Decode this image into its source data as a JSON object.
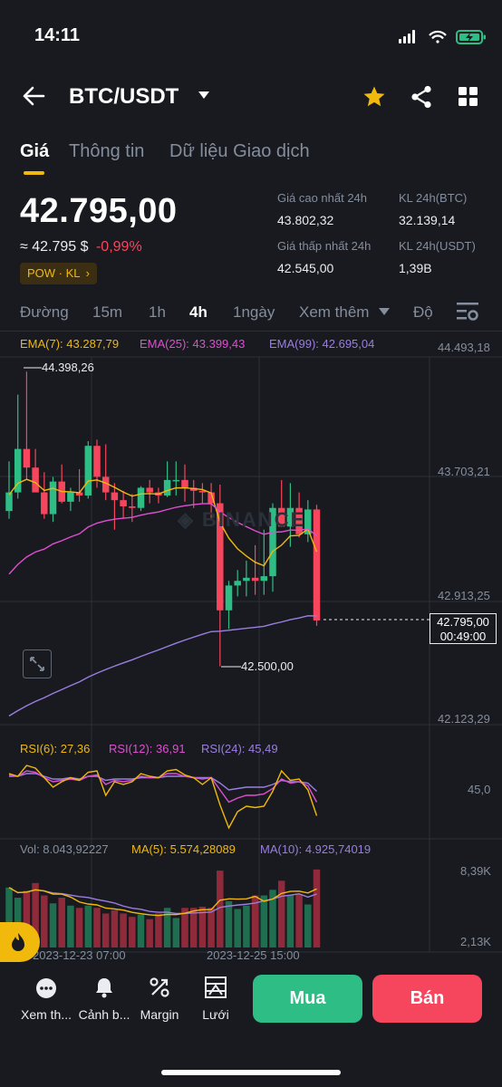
{
  "status": {
    "time": "14:11"
  },
  "header": {
    "pair": "BTC/USDT"
  },
  "tabs": [
    {
      "label": "Giá"
    },
    {
      "label": "Thông tin"
    },
    {
      "label": "Dữ liệu Giao dịch"
    }
  ],
  "ticker": {
    "last_price": "42.795,00",
    "fiat_price": "≈ 42.795 $",
    "change": "-0,99%",
    "tags": "POW · KL",
    "stats": [
      {
        "label": "Giá cao nhất 24h",
        "value": "43.802,32"
      },
      {
        "label": "KL 24h(BTC)",
        "value": "32.139,14"
      },
      {
        "label": "Giá thấp nhất 24h",
        "value": "42.545,00"
      },
      {
        "label": "KL 24h(USDT)",
        "value": "1,39B"
      }
    ]
  },
  "intervals": {
    "items": [
      "Đường",
      "15m",
      "1h",
      "4h",
      "1ngày"
    ],
    "more": "Xem thêm",
    "depth": "Độ"
  },
  "main_chart": {
    "ema7": "EMA(7): 43.287,79",
    "ema25": "EMA(25): 43.399,43",
    "ema99": "EMA(99): 42.695,04",
    "y_labels": [
      "44.493,18",
      "43.703,21",
      "42.913,25",
      "42.123,29"
    ],
    "high_marker": "44.398,26",
    "low_marker": "42.500,00",
    "current_price": "42.795,00",
    "countdown": "00:49:00"
  },
  "rsi": {
    "rsi6": "RSI(6): 27,36",
    "rsi12": "RSI(12): 36,91",
    "rsi24": "RSI(24): 45,49",
    "level": "45,0"
  },
  "volume": {
    "vol": "Vol: 8.043,92227",
    "ma5": "MA(5): 5.574,28089",
    "ma10": "MA(10): 4.925,74019",
    "top_label": "8,39K",
    "bottom_label": "2,13K",
    "dates": [
      "2023-12-23 07:00",
      "2023-12-25 15:00"
    ]
  },
  "bottom_nav": {
    "items": [
      {
        "label": "Xem th..."
      },
      {
        "label": "Cảnh b..."
      },
      {
        "label": "Margin"
      },
      {
        "label": "Lưới"
      }
    ],
    "buy": "Mua",
    "sell": "Bán"
  },
  "colors": {
    "up": "#2ebd85",
    "down": "#f6465d",
    "accent": "#f0b90b",
    "bg": "#181a20"
  },
  "candles": [
    [
      43500,
      43820,
      43450,
      43620
    ],
    [
      43620,
      44250,
      43580,
      43900
    ],
    [
      43900,
      44398,
      43700,
      43780
    ],
    [
      43780,
      43900,
      43700,
      43620
    ],
    [
      43620,
      43750,
      43450,
      43480
    ],
    [
      43480,
      43720,
      43430,
      43690
    ],
    [
      43690,
      43800,
      43550,
      43560
    ],
    [
      43560,
      43650,
      43500,
      43620
    ],
    [
      43620,
      43770,
      43560,
      43600
    ],
    [
      43600,
      43950,
      43580,
      43920
    ],
    [
      43920,
      43960,
      43650,
      43720
    ],
    [
      43720,
      43930,
      43570,
      43620
    ],
    [
      43620,
      43680,
      43380,
      43570
    ],
    [
      43570,
      43630,
      43450,
      43530
    ],
    [
      43530,
      43610,
      43430,
      43520
    ],
    [
      43520,
      43660,
      43500,
      43650
    ],
    [
      43650,
      43700,
      43550,
      43620
    ],
    [
      43620,
      43650,
      43550,
      43600
    ],
    [
      43600,
      43820,
      43590,
      43700
    ],
    [
      43700,
      43820,
      43600,
      43700
    ],
    [
      43700,
      43800,
      43560,
      43650
    ],
    [
      43650,
      43700,
      43520,
      43630
    ],
    [
      43630,
      43680,
      43550,
      43620
    ],
    [
      43620,
      43680,
      43450,
      43550
    ],
    [
      43550,
      43670,
      42500,
      42860
    ],
    [
      42860,
      43050,
      42740,
      43020
    ],
    [
      43020,
      43120,
      42950,
      43050
    ],
    [
      43050,
      43180,
      42950,
      43070
    ],
    [
      43070,
      43280,
      42960,
      43050
    ],
    [
      43050,
      43380,
      42960,
      43080
    ],
    [
      43080,
      43550,
      42980,
      43520
    ],
    [
      43520,
      43700,
      43400,
      43400
    ],
    [
      43400,
      43680,
      43270,
      43520
    ],
    [
      43520,
      43620,
      43330,
      43350
    ],
    [
      43350,
      43570,
      43300,
      43510
    ],
    [
      43510,
      43540,
      42760,
      42795
    ]
  ],
  "rsi_series": {
    "rsi6": [
      58,
      56,
      64,
      62,
      55,
      48,
      52,
      55,
      53,
      59,
      60,
      42,
      52,
      50,
      52,
      58,
      56,
      55,
      60,
      61,
      57,
      55,
      50,
      55,
      35,
      18,
      30,
      34,
      33,
      34,
      45,
      60,
      53,
      54,
      46,
      27
    ],
    "rsi12": [
      57,
      56,
      60,
      59,
      55,
      52,
      53,
      54,
      53,
      56,
      57,
      50,
      53,
      52,
      53,
      56,
      55,
      55,
      58,
      58,
      56,
      55,
      54,
      55,
      46,
      37,
      40,
      42,
      42,
      43,
      47,
      54,
      51,
      52,
      49,
      37
    ],
    "rsi24": [
      56,
      56,
      58,
      58,
      56,
      54,
      54,
      55,
      54,
      56,
      56,
      53,
      54,
      54,
      54,
      55,
      55,
      55,
      56,
      56,
      56,
      55,
      55,
      55,
      51,
      46,
      47,
      48,
      48,
      48,
      50,
      53,
      52,
      52,
      51,
      45
    ]
  },
  "volume_series": [
    6.8,
    5.9,
    6.5,
    7.2,
    6.1,
    5.4,
    5.9,
    5.2,
    5.0,
    5.2,
    5.0,
    4.5,
    4.8,
    4.5,
    4.2,
    4.4,
    4.0,
    4.5,
    5.0,
    4.1,
    5.0,
    5.0,
    5.1,
    5.0,
    8.3,
    5.6,
    4.9,
    5.2,
    6.1,
    6.1,
    6.6,
    7.4,
    6.1,
    6.2,
    5.3,
    8.4
  ]
}
